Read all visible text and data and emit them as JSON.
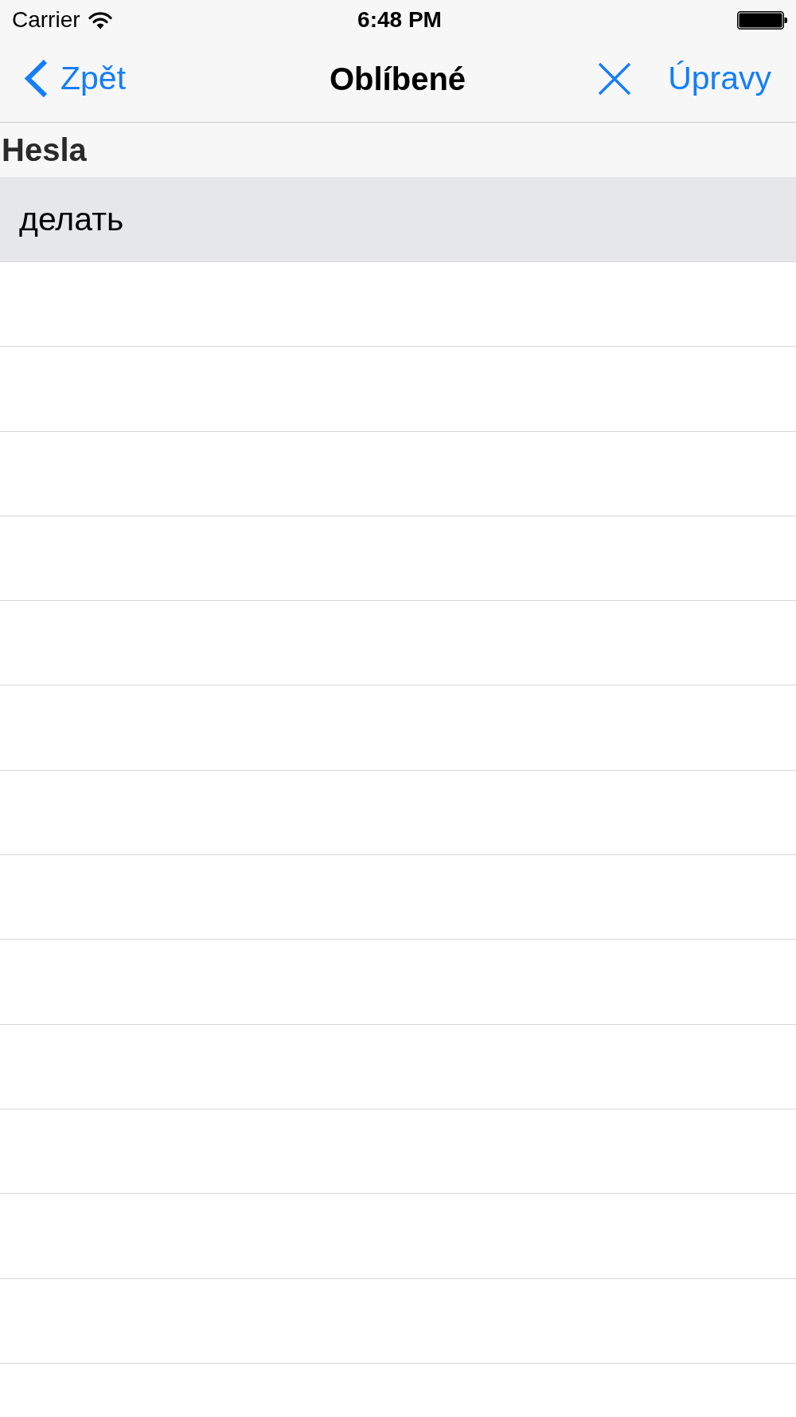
{
  "status_bar": {
    "carrier": "Carrier",
    "time": "6:48 PM"
  },
  "nav_bar": {
    "back": "Zpět",
    "title": "Oblíbené",
    "edit": "Úpravy"
  },
  "sections": [
    {
      "header": "Hesla",
      "rows": [
        {
          "label": "делать",
          "selected": true
        }
      ]
    }
  ]
}
